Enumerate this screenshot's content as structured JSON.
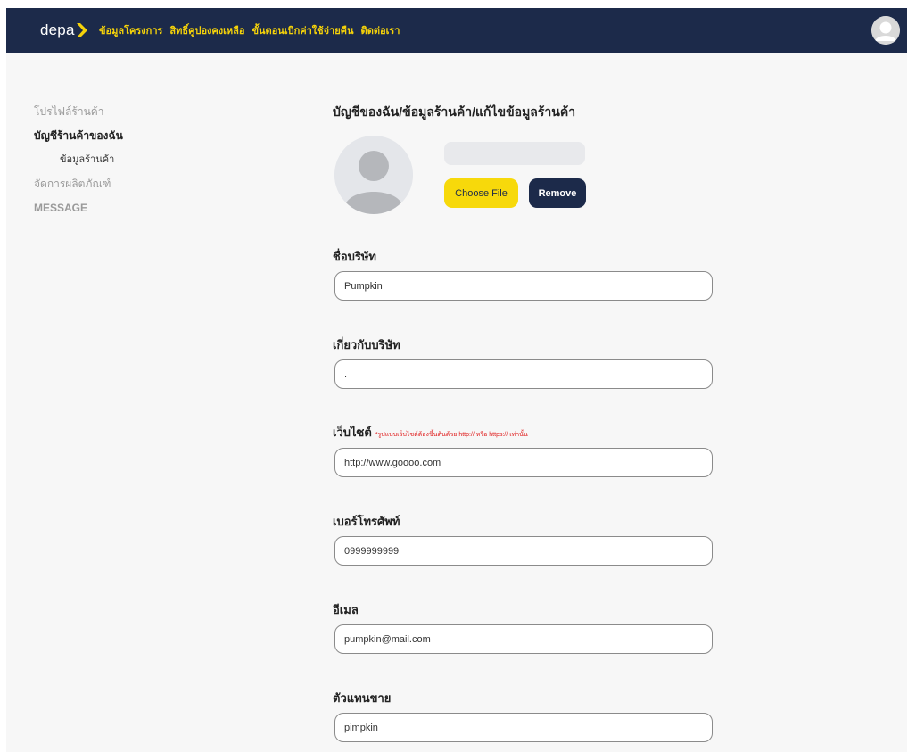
{
  "header": {
    "logo_text": "depa",
    "nav": [
      "ข้อมูลโครงการ",
      "สิทธิ์คูปองคงเหลือ",
      "ขั้นตอนเบิกค่าใช้จ่ายคืน",
      "ติดต่อเรา"
    ],
    "colors": {
      "bar": "#1c2a4a",
      "accent": "#f5d20a"
    }
  },
  "sidebar": {
    "items": [
      {
        "label": "โปรไฟล์ร้านค้า",
        "state": "inactive"
      },
      {
        "label": "บัญชีร้านค้าของฉัน",
        "state": "active"
      },
      {
        "label": "ข้อมูลร้านค้า",
        "state": "sub"
      },
      {
        "label": "จัดการผลิตภัณฑ์",
        "state": "inactive"
      },
      {
        "label": "MESSAGE",
        "state": "inactive"
      }
    ]
  },
  "main": {
    "title": "บัญชีของฉัน/ข้อมูลร้านค้า/แก้ไขข้อมูลร้านค้า",
    "choose_file_label": "Choose File",
    "remove_label": "Remove",
    "fields": [
      {
        "label": "ชื่อบริษัท",
        "value": "Pumpkin"
      },
      {
        "label": "เกี่ยวกับบริษัท",
        "value": "."
      },
      {
        "label": "เว็บไซต์",
        "hint": "*รูปแบบเว็บไซต์ต้องขึ้นต้นด้วย http:// หรือ https:// เท่านั้น",
        "value": "http://www.goooo.com"
      },
      {
        "label": "เบอร์โทรศัพท์",
        "value": "0999999999"
      },
      {
        "label": "อีเมล",
        "value": "pumpkin@mail.com"
      },
      {
        "label": "ตัวแทนขาย",
        "value": "pimpkin"
      }
    ]
  }
}
